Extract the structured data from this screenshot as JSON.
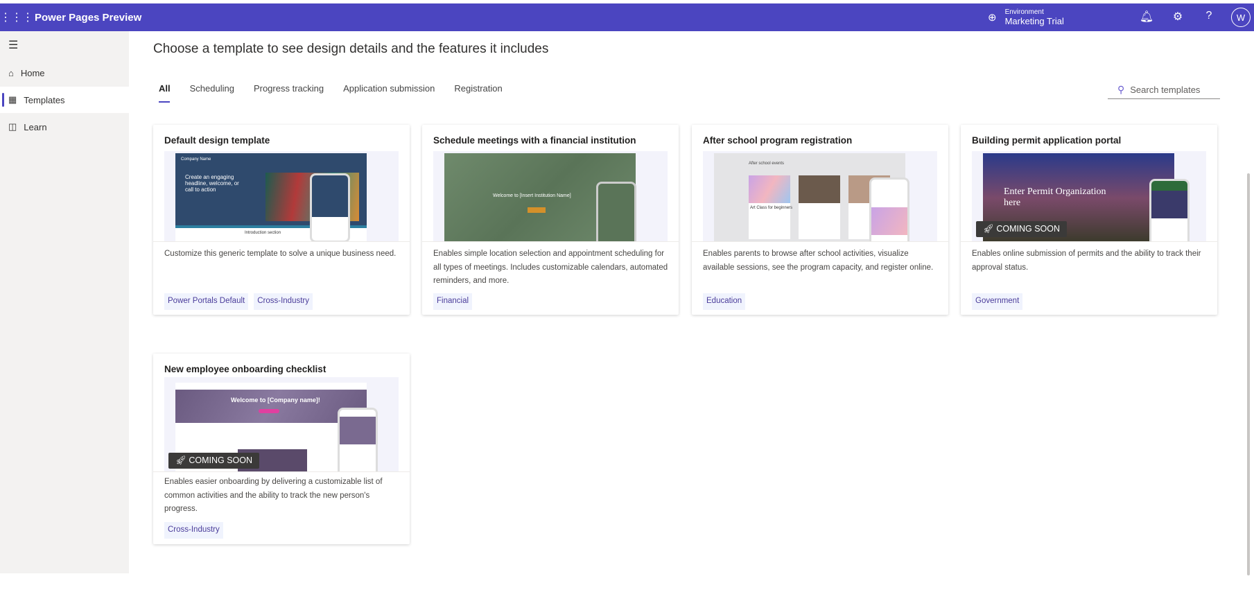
{
  "app": {
    "title": "Power Pages Preview",
    "environment_label": "Environment",
    "environment_name": "Marketing Trial",
    "avatar_initials": "W"
  },
  "sidebar": {
    "items": [
      {
        "label": "Home",
        "icon": "home-icon"
      },
      {
        "label": "Templates",
        "icon": "templates-icon",
        "active": true
      },
      {
        "label": "Learn",
        "icon": "book-icon"
      }
    ]
  },
  "main": {
    "heading": "Choose a template to see design details and the features it includes",
    "tabs": [
      {
        "label": "All",
        "active": true
      },
      {
        "label": "Scheduling"
      },
      {
        "label": "Progress tracking"
      },
      {
        "label": "Application submission"
      },
      {
        "label": "Registration"
      }
    ],
    "search_placeholder": "Search templates",
    "cards": [
      {
        "title": "Default design template",
        "description": "Customize this generic template to solve a unique business need.",
        "tags": [
          "Power Portals Default",
          "Cross-Industry"
        ],
        "preview": {
          "headline": "Create an engaging headline, welcome, or call to action",
          "section": "Introduction section",
          "company": "Company Name"
        }
      },
      {
        "title": "Schedule meetings with a financial institution",
        "description": "Enables simple location selection and appointment scheduling for all types of meetings. Includes customizable calendars, automated reminders, and more.",
        "tags": [
          "Financial"
        ],
        "preview": {
          "headline": "Welcome to [Insert Institution Name]"
        }
      },
      {
        "title": "After school program registration",
        "description": "Enables parents to browse after school activities, visualize available sessions, see the program capacity, and register online.",
        "tags": [
          "Education"
        ],
        "preview": {
          "headline": "After school events",
          "item": "Art Class for beginners"
        }
      },
      {
        "title": "Building permit application portal",
        "description": "Enables online submission of permits and the ability to track their approval status.",
        "tags": [
          "Government"
        ],
        "badge": "COMING SOON",
        "preview": {
          "headline": "Enter Permit Organization here"
        }
      },
      {
        "title": "New employee onboarding checklist",
        "description": "Enables easier onboarding by delivering a customizable list of common activities and the ability to track the new person's progress.",
        "tags": [
          "Cross-Industry"
        ],
        "badge": "COMING SOON",
        "preview": {
          "headline": "Welcome to [Company name]!"
        }
      }
    ]
  }
}
